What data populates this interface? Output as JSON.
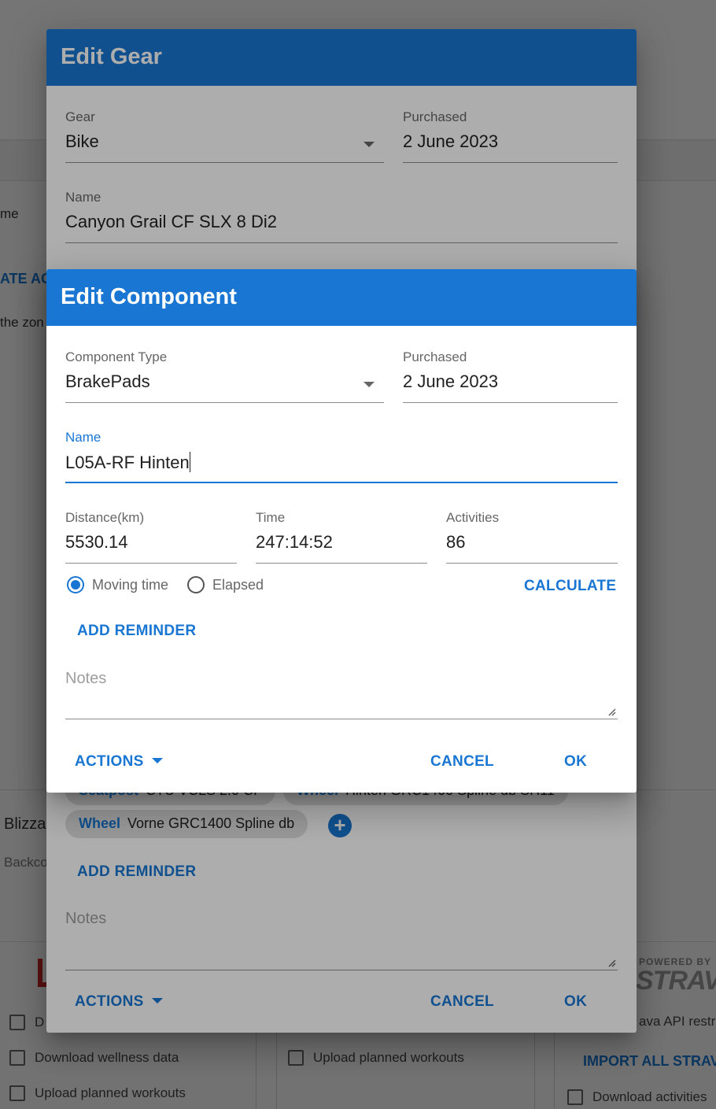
{
  "background": {
    "fragments": {
      "name_label": "me",
      "action_link": "ATE AC",
      "zone_text": "the zon",
      "blizzard": "Blizza",
      "backco": "Backco"
    },
    "strava": {
      "powered": "POWERED BY",
      "word": "STRAV",
      "api_note": "ava API restr",
      "import_link": "IMPORT ALL STRAV"
    },
    "checkboxes": {
      "col1_first": "D",
      "col1_second": "Download wellness data",
      "col1_third": "Upload planned workouts",
      "col2_first": "Upload planned workouts",
      "col3_first": "Download activities"
    }
  },
  "edit_gear": {
    "title": "Edit Gear",
    "gear": {
      "label": "Gear",
      "value": "Bike"
    },
    "purchased": {
      "label": "Purchased",
      "value": "2 June 2023"
    },
    "name": {
      "label": "Name",
      "value": "Canyon Grail CF SLX 8 Di2"
    },
    "chips": [
      {
        "type": "Seatpost",
        "name": "CTU VCLS 2.0 CF"
      },
      {
        "type": "Wheel",
        "name": "Hinten GRC1400 Spline db SH11"
      },
      {
        "type": "Wheel",
        "name": "Vorne GRC1400 Spline db"
      }
    ],
    "add_component": "+",
    "add_reminder": "ADD REMINDER",
    "notes_placeholder": "Notes",
    "actions": "ACTIONS",
    "cancel": "CANCEL",
    "ok": "OK"
  },
  "edit_component": {
    "title": "Edit Component",
    "component_type": {
      "label": "Component Type",
      "value": "BrakePads"
    },
    "purchased": {
      "label": "Purchased",
      "value": "2 June 2023"
    },
    "name": {
      "label": "Name",
      "value": "L05A-RF Hinten"
    },
    "distance": {
      "label": "Distance(km)",
      "value": "5530.14"
    },
    "time": {
      "label": "Time",
      "value": "247:14:52"
    },
    "activities": {
      "label": "Activities",
      "value": "86"
    },
    "radio_moving": "Moving time",
    "radio_elapsed": "Elapsed",
    "selected_radio": "Moving time",
    "calculate": "CALCULATE",
    "add_reminder": "ADD REMINDER",
    "notes_placeholder": "Notes",
    "actions": "ACTIONS",
    "cancel": "CANCEL",
    "ok": "OK"
  },
  "colors": {
    "primary": "#1976d2",
    "scrim": "rgba(0,0,0,0.32)"
  }
}
